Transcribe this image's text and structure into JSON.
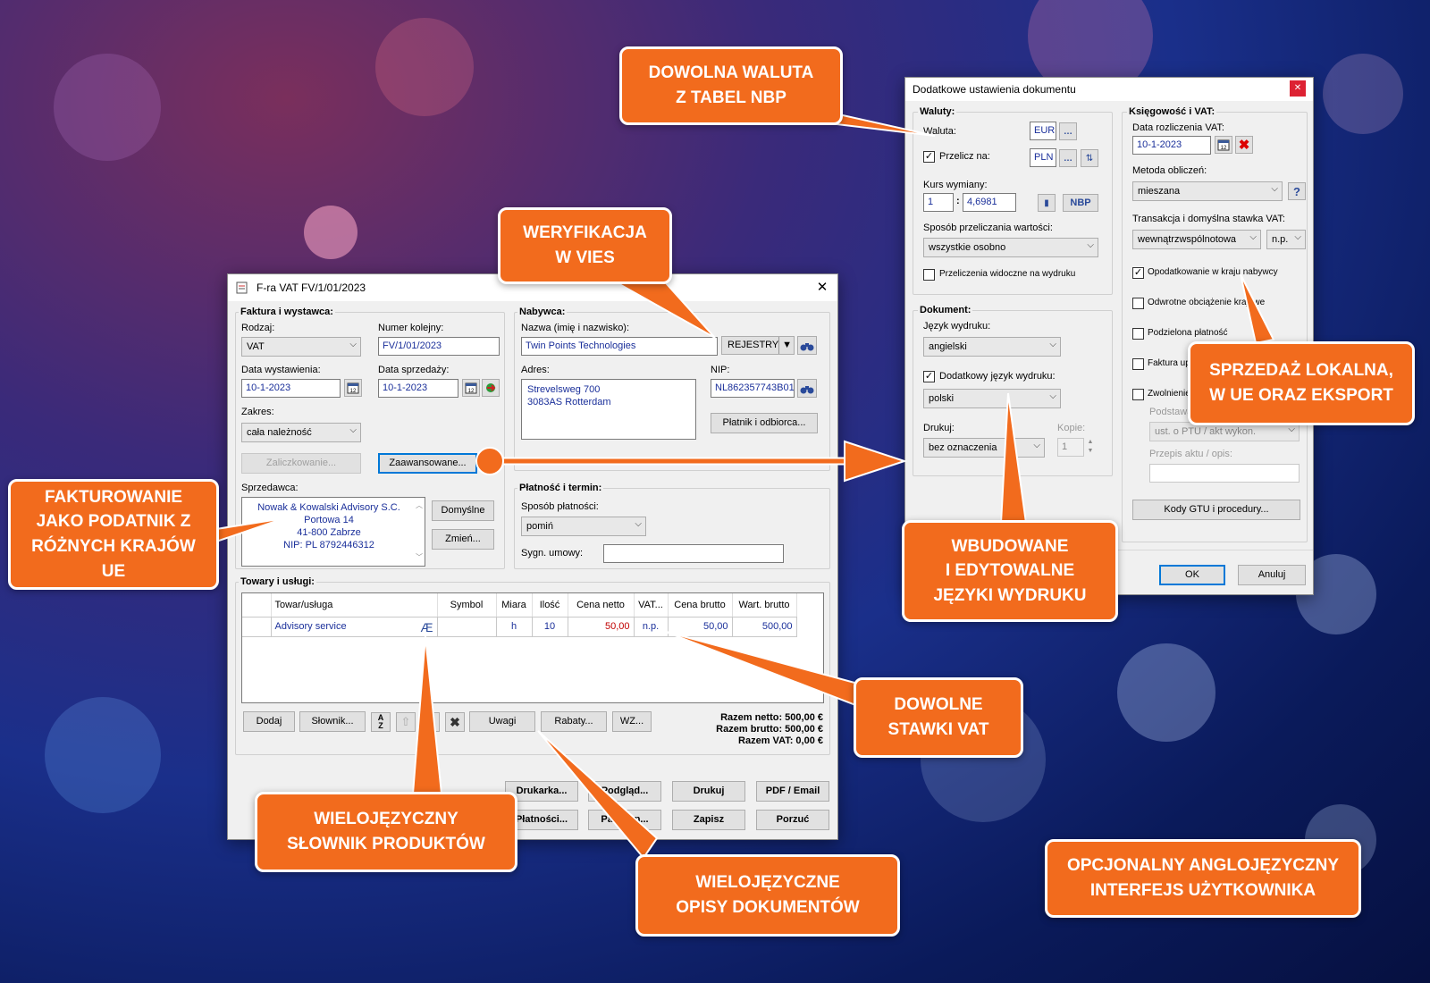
{
  "colors": {
    "accent": "#f26b1d",
    "link_blue": "#1a2f9a",
    "price_red": "#c00000"
  },
  "callouts": {
    "currency": [
      "DOWOLNA WALUTA",
      "Z TABEL NBP"
    ],
    "vies": [
      "WERYFIKACJA",
      "W VIES"
    ],
    "taxpayer": [
      "FAKTUROWANIE",
      "JAKO PODATNIK Z",
      "RÓŻNYCH KRAJÓW UE"
    ],
    "sales": [
      "SPRZEDAŻ LOKALNA,",
      "W UE ORAZ EKSPORT"
    ],
    "languages": [
      "WBUDOWANE",
      "I EDYTOWALNE",
      "JĘZYKI WYDRUKU"
    ],
    "vat": [
      "DOWOLNE",
      "STAWKI VAT"
    ],
    "dictionary": [
      "WIELOJĘZYCZNY",
      "SŁOWNIK PRODUKTÓW"
    ],
    "descriptions": [
      "WIELOJĘZYCZNE",
      "OPISY DOKUMENTÓW"
    ],
    "interface": [
      "OPCJONALNY ANGLOJĘZYCZNY",
      "INTERFEJS UŻYTKOWNIKA"
    ]
  },
  "invoice": {
    "title": "F-ra VAT FV/1/01/2023",
    "seller_section": {
      "header": "Faktura i wystawca:",
      "type_label": "Rodzaj:",
      "type_value": "VAT",
      "number_label": "Numer kolejny:",
      "number_value": "FV/1/01/2023",
      "issue_label": "Data wystawienia:",
      "issue_value": "10-1-2023",
      "sale_label": "Data sprzedaży:",
      "sale_value": "10-1-2023",
      "scope_label": "Zakres:",
      "scope_value": "cała należność",
      "advance_button": "Zaliczkowanie...",
      "advanced_button": "Zaawansowane...",
      "seller_label": "Sprzedawca:",
      "seller_lines": [
        "Nowak & Kowalski Advisory S.C.",
        "Portowa 14",
        "41-800 Zabrze",
        "NIP: PL 8792446312"
      ],
      "default_button": "Domyślne",
      "change_button": "Zmień..."
    },
    "buyer_section": {
      "header": "Nabywca:",
      "name_label": "Nazwa (imię i nazwisko):",
      "name_value": "Twin Points Technologies",
      "registries_button": "REJESTRY",
      "address_label": "Adres:",
      "address_lines": [
        "Strevelsweg 700",
        "3083AS Rotterdam"
      ],
      "nip_label": "NIP:",
      "nip_value": "NL862357743B01",
      "payer_button": "Płatnik i odbiorca..."
    },
    "payment_section": {
      "header": "Płatność i termin:",
      "method_label": "Sposób płatności:",
      "method_value": "pomiń",
      "contract_label": "Sygn. umowy:"
    },
    "goods": {
      "header": "Towary i usługi:",
      "columns": [
        "Towar/usługa",
        "Symbol",
        "Miara",
        "Ilość",
        "Cena netto",
        "VAT...",
        "Cena brutto",
        "Wart. brutto"
      ],
      "rows": [
        {
          "name": "Advisory service",
          "symbol": "",
          "unit": "h",
          "qty": "10",
          "net": "50,00",
          "vat": "n.p.",
          "gross": "50,00",
          "total": "500,00"
        }
      ],
      "buttons": {
        "add": "Dodaj",
        "dictionary": "Słownik...",
        "notes": "Uwagi",
        "discounts": "Rabaty...",
        "wz": "WZ..."
      },
      "totals": [
        "Razem netto: 500,00 €",
        "Razem brutto: 500,00 €",
        "Razem VAT: 0,00 €"
      ]
    },
    "footer_buttons": {
      "printer": "Drukarka...",
      "preview": "Podgląd...",
      "print": "Drukuj",
      "pdf": "PDF / Email",
      "payments": "Płatności...",
      "coupon": "Paragon...",
      "save": "Zapisz",
      "discard": "Porzuć"
    }
  },
  "settings": {
    "title": "Dodatkowe ustawienia dokumentu",
    "currencies": {
      "header": "Waluty:",
      "currency_label": "Waluta:",
      "currency_value": "EUR",
      "convert_label": "Przelicz na:",
      "convert_value": "PLN",
      "convert_checked": true,
      "rate_label": "Kurs wymiany:",
      "rate_qty": "1",
      "rate_value": "4,6981",
      "nbp_button": "NBP",
      "method_label": "Sposób przeliczania wartości:",
      "method_value": "wszystkie osobno",
      "visible_label": "Przeliczenia widoczne na wydruku",
      "visible_checked": false
    },
    "document": {
      "header": "Dokument:",
      "lang_label": "Język wydruku:",
      "lang_value": "angielski",
      "extra_lang_label": "Dodatkowy język wydruku:",
      "extra_lang_checked": true,
      "extra_lang_value": "polski",
      "print_label": "Drukuj:",
      "print_value": "bez oznaczenia",
      "copies_label": "Kopie:",
      "copies_value": "1"
    },
    "accounting": {
      "header": "Księgowość i VAT:",
      "settle_label": "Data rozliczenia VAT:",
      "settle_value": "10-1-2023",
      "calc_label": "Metoda obliczeń:",
      "calc_value": "mieszana",
      "transaction_label": "Transakcja i domyślna stawka VAT:",
      "transaction_value": "wewnątrzwspólnotowa",
      "rate_value": "n.p.",
      "checks": [
        {
          "label": "Opodatkowanie w kraju nabywcy",
          "checked": true
        },
        {
          "label": "Odwrotne obciążenie krajowe",
          "checked": false
        },
        {
          "label": "Podzielona płatność",
          "checked": false
        },
        {
          "label": "Faktura uproszczona",
          "checked": false
        },
        {
          "label": "Zwolnienie :",
          "checked": false
        }
      ],
      "basis_label": "Podstawa z",
      "basis_value": "ust. o PTU / akt wykon.",
      "rule_label": "Przepis aktu / opis:",
      "gtu_button": "Kody GTU i procedury..."
    },
    "ok_button": "OK",
    "cancel_button": "Anuluj"
  }
}
